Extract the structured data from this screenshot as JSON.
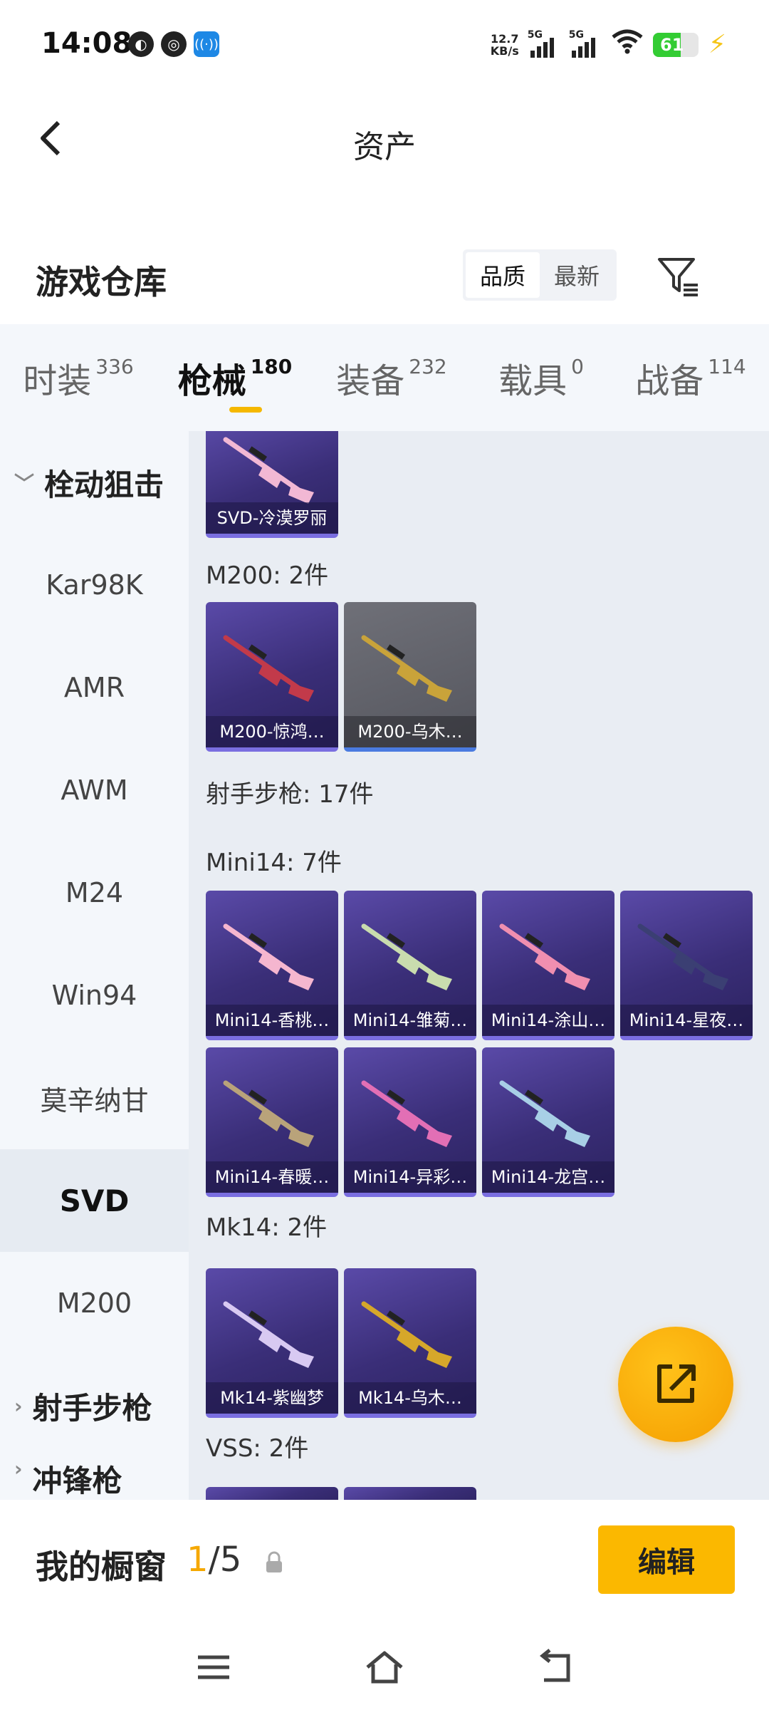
{
  "status_bar": {
    "time": "14:08",
    "left_icons": [
      "soul-app-icon",
      "china-mobile-icon",
      "nfc-hotspot-icon"
    ],
    "net_speed_value": "12.7",
    "net_speed_unit": "KB/s",
    "signal_1_label": "5G",
    "signal_2_label": "5G",
    "battery_level": "61",
    "battery_percent": 61,
    "charging": true
  },
  "header": {
    "title": "资产"
  },
  "warehouse": {
    "title": "游戏仓库",
    "sort_options": [
      "品质",
      "最新"
    ],
    "sort_active_index": 0
  },
  "tabs": [
    {
      "name": "时装",
      "count": "336",
      "active": false
    },
    {
      "name": "枪械",
      "count": "180",
      "active": true
    },
    {
      "name": "装备",
      "count": "232",
      "active": false
    },
    {
      "name": "载具",
      "count": "0",
      "active": false
    },
    {
      "name": "战备",
      "count": "114",
      "active": false
    }
  ],
  "sidebar": {
    "group_expanded": "栓动狙击",
    "items": [
      "Kar98K",
      "AMR",
      "AWM",
      "M24",
      "Win94",
      "莫辛纳甘",
      "SVD",
      "M200"
    ],
    "selected": "SVD",
    "group_collapsed": "射手步枪",
    "group_partial": "冲锋枪"
  },
  "content": {
    "top_card": {
      "caption": "SVD-冷漠罗丽",
      "style": "purple",
      "gun_color": "#f2b8d4"
    },
    "sections": [
      {
        "label": "M200: 2件"
      },
      {
        "label": "射手步枪: 17件"
      },
      {
        "label": "Mini14: 7件"
      },
      {
        "label": "Mk14: 2件"
      },
      {
        "label": "VSS: 2件"
      }
    ],
    "m200_cards": [
      {
        "caption": "M200-惊鸿…",
        "style": "purple",
        "gun_color": "#c23a4a"
      },
      {
        "caption": "M200-乌木…",
        "style": "grey",
        "gun_color": "#c9a33a"
      }
    ],
    "mini14_cards": [
      {
        "caption": "Mini14-香桃…",
        "style": "purple",
        "gun_color": "#f5b6cf"
      },
      {
        "caption": "Mini14-雏菊…",
        "style": "purple",
        "gun_color": "#c9dcae"
      },
      {
        "caption": "Mini14-涂山…",
        "style": "purple",
        "gun_color": "#f08fb0"
      },
      {
        "caption": "Mini14-星夜…",
        "style": "purple",
        "gun_color": "#3b3f73"
      },
      {
        "caption": "Mini14-春暖…",
        "style": "purple",
        "gun_color": "#b9a37a"
      },
      {
        "caption": "Mini14-异彩…",
        "style": "purple",
        "gun_color": "#e26fb5"
      },
      {
        "caption": "Mini14-龙宫…",
        "style": "purple",
        "gun_color": "#a8cfe6"
      }
    ],
    "mk14_cards": [
      {
        "caption": "Mk14-紫幽梦",
        "style": "purple",
        "gun_color": "#d8c9f2"
      },
      {
        "caption": "Mk14-乌木…",
        "style": "purple",
        "gun_color": "#d6a72a"
      }
    ]
  },
  "showcase": {
    "title": "我的橱窗",
    "current": "1",
    "separator": "/",
    "total": "5",
    "edit_label": "编辑"
  },
  "navbar": {
    "icons": [
      "menu-icon",
      "home-icon",
      "back-nav-icon"
    ]
  },
  "colors": {
    "accent": "#f5b800",
    "card_purple": "#3a2e78",
    "card_grey": "#5f6068",
    "sidebar_bg": "#f4f7fb",
    "content_bg": "#e9edf3"
  }
}
